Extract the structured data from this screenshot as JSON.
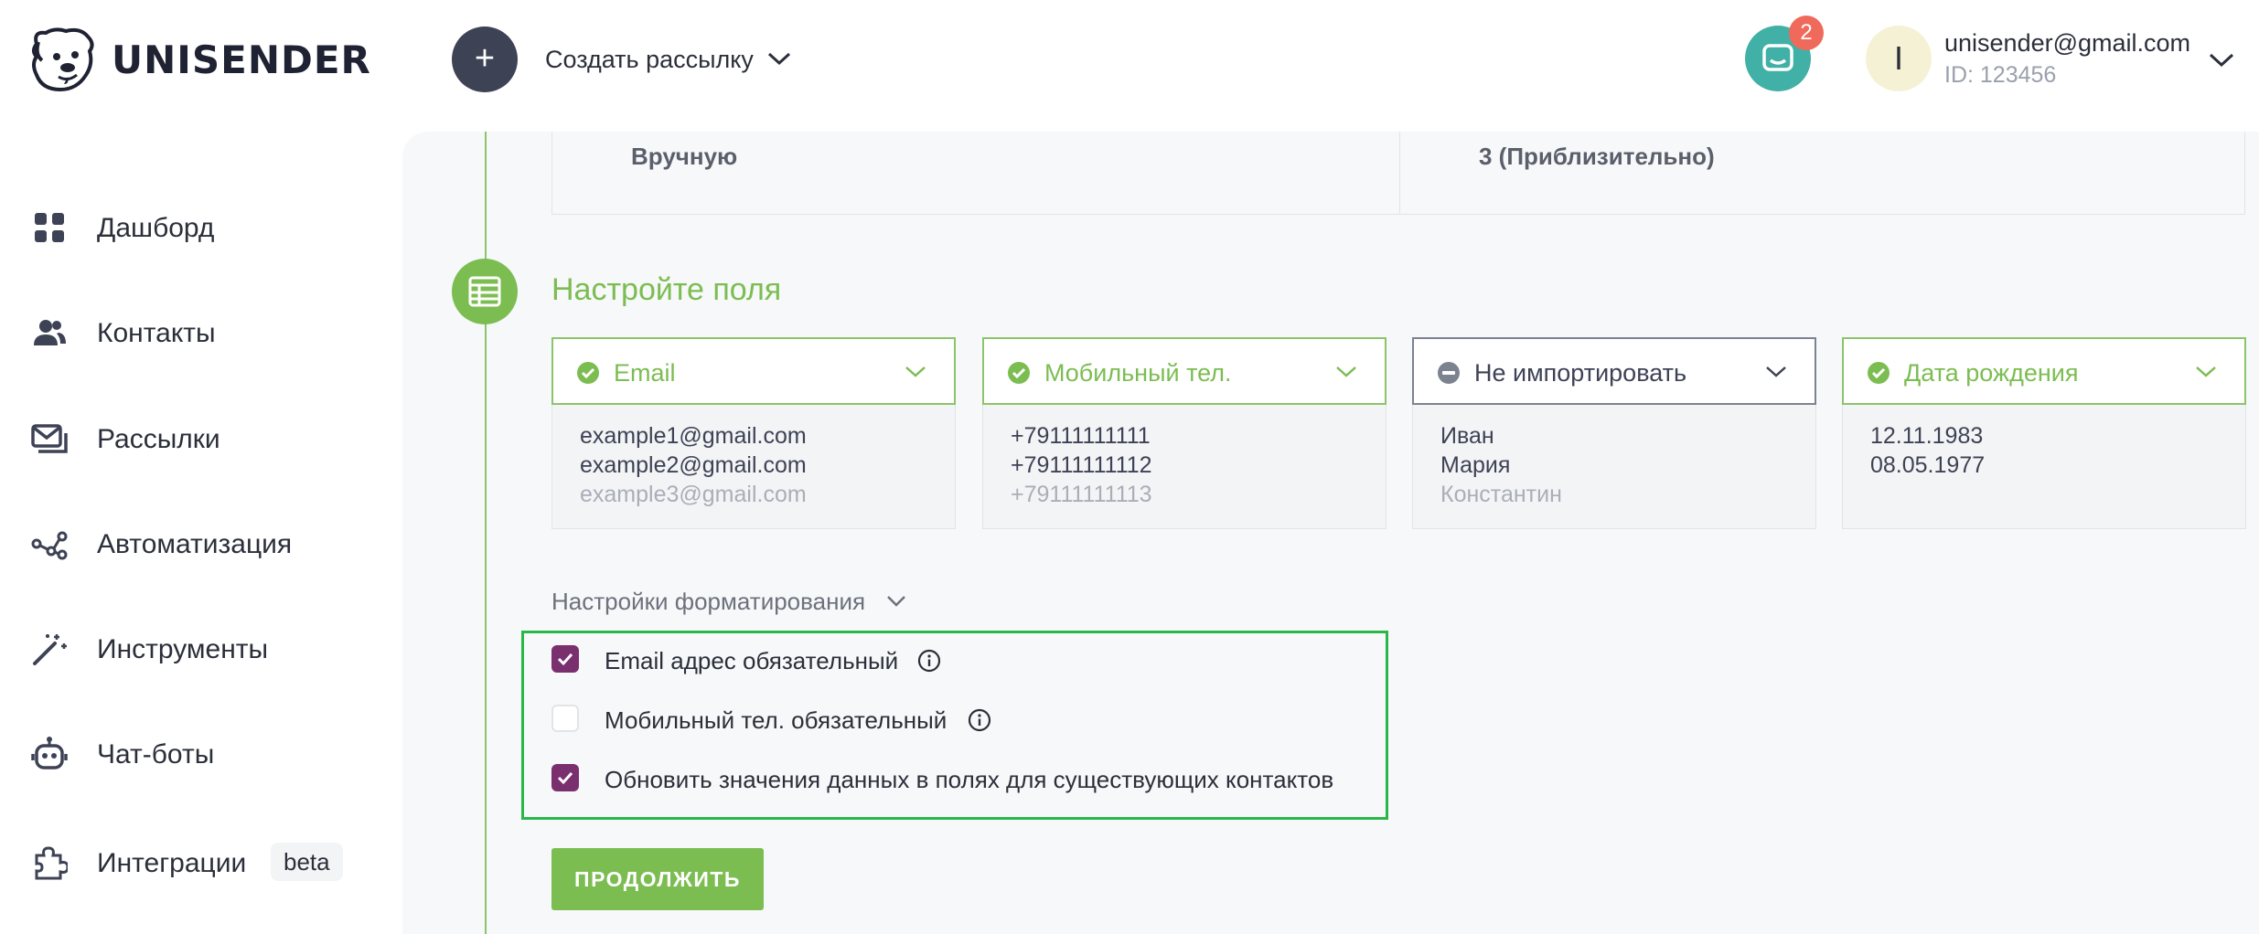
{
  "brand": {
    "name": "UNISENDER"
  },
  "header": {
    "create_label": "Создать рассылку",
    "notifications_count": "2",
    "avatar_letter": "I",
    "account_email": "unisender@gmail.com",
    "account_id": "ID: 123456"
  },
  "sidebar": {
    "items": [
      {
        "label": "Дашборд",
        "icon": "dashboard-icon"
      },
      {
        "label": "Контакты",
        "icon": "contacts-icon"
      },
      {
        "label": "Рассылки",
        "icon": "campaigns-icon"
      },
      {
        "label": "Автоматизация",
        "icon": "automation-icon"
      },
      {
        "label": "Инструменты",
        "icon": "magic-wand-icon"
      },
      {
        "label": "Чат-боты",
        "icon": "robot-icon"
      },
      {
        "label": "Интеграции",
        "icon": "puzzle-icon",
        "badge": "beta"
      }
    ]
  },
  "summary": {
    "method": "Вручную",
    "count": "3 (Приблизительно)"
  },
  "step": {
    "title": "Настройте поля"
  },
  "columns": [
    {
      "header": "Email",
      "status": "mapped",
      "values": [
        "example1@gmail.com",
        "example2@gmail.com",
        "example3@gmail.com"
      ]
    },
    {
      "header": "Мобильный тел.",
      "status": "mapped",
      "values": [
        "+79111111111",
        "+79111111112",
        "+79111111113"
      ]
    },
    {
      "header": "Не импортировать",
      "status": "skipped",
      "values": [
        "Иван",
        "Мария",
        "Константин"
      ]
    },
    {
      "header": "Дата рождения",
      "status": "mapped",
      "values": [
        "12.11.1983",
        "08.05.1977",
        ""
      ]
    }
  ],
  "formatting": {
    "toggle_label": "Настройки форматирования",
    "options": [
      {
        "label": "Email адрес обязательный",
        "checked": true,
        "has_info": true
      },
      {
        "label": "Мобильный тел. обязательный",
        "checked": false,
        "has_info": true
      },
      {
        "label": "Обновить значения данных в полях для существующих контактов",
        "checked": true,
        "has_info": false
      }
    ]
  },
  "actions": {
    "continue_label": "ПРОДОЛЖИТЬ"
  },
  "colors": {
    "accent_green": "#7cbd52",
    "checkbox_purple": "#7a2f6f",
    "highlight_green": "#2ab74a",
    "chat_teal": "#41b0a6",
    "badge_red": "#ef6a5a"
  }
}
